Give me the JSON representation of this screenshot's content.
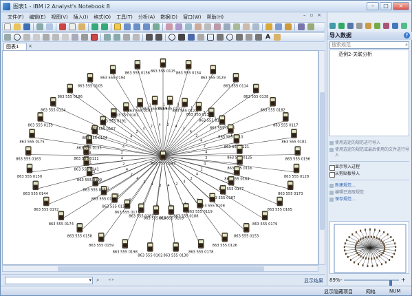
{
  "window": {
    "title": "图表1 - IBM i2 Analyst's Notebook 8"
  },
  "menu": [
    {
      "id": "file",
      "label": "文件(F)"
    },
    {
      "id": "edit",
      "label": "编辑(E)"
    },
    {
      "id": "view",
      "label": "视图(V)"
    },
    {
      "id": "insert",
      "label": "插入(I)"
    },
    {
      "id": "format",
      "label": "格式(O)"
    },
    {
      "id": "tools",
      "label": "工具(T)"
    },
    {
      "id": "analysis",
      "label": "分析(A)"
    },
    {
      "id": "data",
      "label": "数据(D)"
    },
    {
      "id": "window",
      "label": "窗口(W)"
    },
    {
      "id": "help",
      "label": "帮助(H)"
    }
  ],
  "toolbar": {
    "text_tool": "A"
  },
  "tab": {
    "label": "图表1",
    "close": "×"
  },
  "chart": {
    "center": {
      "label": "863 555 0143"
    },
    "nodes": [
      {
        "label": "863 555 0115"
      },
      {
        "label": "863 555 0132"
      },
      {
        "label": "863 555 0154"
      },
      {
        "label": "863 555 0122"
      },
      {
        "label": "863 555 0129"
      },
      {
        "label": "863 555 0137"
      },
      {
        "label": "863 555 0114"
      },
      {
        "label": "863 555 0113"
      },
      {
        "label": "863 555 0138"
      },
      {
        "label": "863 555 0146"
      },
      {
        "label": "863 555 0182"
      },
      {
        "label": "863 555 0110"
      },
      {
        "label": "863 555 0117"
      },
      {
        "label": "863 555 0121"
      },
      {
        "label": "863 555 0181"
      },
      {
        "label": "863 555 0125"
      },
      {
        "label": "863 555 0196"
      },
      {
        "label": "863 555 0116"
      },
      {
        "label": "863 555 0128"
      },
      {
        "label": "863 555 0164"
      },
      {
        "label": "863 555 0173"
      },
      {
        "label": "863 555 0177"
      },
      {
        "label": "863 555 0165"
      },
      {
        "label": "863 555 0187"
      },
      {
        "label": "863 555 0179"
      },
      {
        "label": "863 555 0108"
      },
      {
        "label": "863 555 0153"
      },
      {
        "label": "863 555 0119"
      },
      {
        "label": "863 555 0126"
      },
      {
        "label": "863 555 0188"
      },
      {
        "label": "863 555 0178"
      },
      {
        "label": "863 555 0109"
      },
      {
        "label": "863 555 0130"
      },
      {
        "label": "863 555 0140"
      },
      {
        "label": "863 555 0102"
      },
      {
        "label": "863 555 0183"
      },
      {
        "label": "863 555 0198"
      },
      {
        "label": "863 555 0171"
      },
      {
        "label": "863 555 0159"
      },
      {
        "label": "863 555 0157"
      },
      {
        "label": "863 555 0158"
      },
      {
        "label": "863 555 0185"
      },
      {
        "label": "863 555 0174"
      },
      {
        "label": "863 555 0151"
      },
      {
        "label": "863 555 0172"
      },
      {
        "label": "863 555 0120"
      },
      {
        "label": "863 555 0144"
      },
      {
        "label": "863 555 0141"
      },
      {
        "label": "863 555 0150"
      },
      {
        "label": "863 555 0111"
      },
      {
        "label": "863 555 0163"
      },
      {
        "label": "863 555 0133"
      },
      {
        "label": "863 555 0175"
      },
      {
        "label": "863 555 0104"
      },
      {
        "label": "863 555 0135"
      },
      {
        "label": "863 555 0167"
      },
      {
        "label": "863 555 0134"
      },
      {
        "label": "863 555 0191"
      },
      {
        "label": "863 555 0186"
      },
      {
        "label": "863 555 0107"
      },
      {
        "label": "863 555 0105"
      },
      {
        "label": "863 555 0193"
      },
      {
        "label": "863 555 0194"
      },
      {
        "label": "863 555 0169"
      },
      {
        "label": "863 555 0156"
      }
    ]
  },
  "findbar": {
    "show_results": "显示结果"
  },
  "right_panel": {
    "header": "导入数据",
    "help": "?",
    "search_placeholder": "搜索规范",
    "list": [
      {
        "label": "范例2-关联分析"
      }
    ],
    "actions": [
      {
        "id": "import_selected",
        "label": "使用选定的规范进行导入",
        "style": "disabled"
      },
      {
        "id": "import_selected_then_file",
        "label": "使用选定的规范或最后使用的文件进行导入",
        "style": "disabled"
      },
      {
        "id": "show_import_process",
        "label": "显示导入过程",
        "style": "check"
      },
      {
        "id": "import_clipboard",
        "label": "从剪贴板导入",
        "style": "check"
      },
      {
        "id": "new_spec",
        "label": "新建规范...",
        "style": "link"
      },
      {
        "id": "edit_spec",
        "label": "编辑已选取规范",
        "style": "disabled"
      },
      {
        "id": "save_spec",
        "label": "保存规范...",
        "style": "link"
      }
    ]
  },
  "zoom": {
    "value": "89%"
  },
  "status": {
    "hidden": "显示隐藏项目",
    "grid": "网格",
    "num": "NUM"
  },
  "colors": {
    "accent": "#dde7f4",
    "link": "#2e62b0",
    "node_body": "#5a4630"
  }
}
